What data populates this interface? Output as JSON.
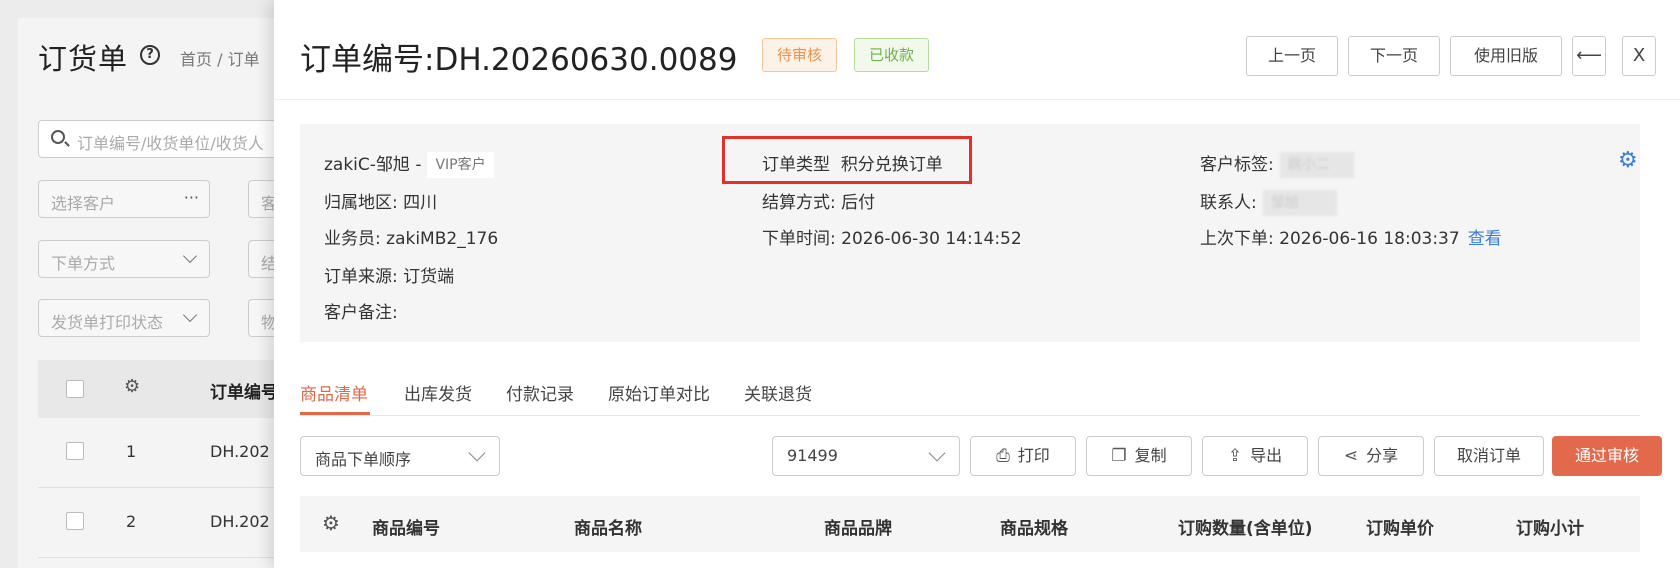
{
  "background": {
    "title": "订货单",
    "help_icon": "?",
    "breadcrumb": "首页 / 订单",
    "search_placeholder": "订单编号/收货单位/收货人",
    "filters": [
      {
        "label": "选择客户",
        "tail": "···"
      },
      {
        "label": "客"
      },
      {
        "label": "下单方式"
      },
      {
        "label": "结"
      },
      {
        "label": "发货单打印状态"
      },
      {
        "label": "物"
      }
    ],
    "table": {
      "order_no_header": "订单编号",
      "rows": [
        {
          "index": "1",
          "order_no": "DH.202"
        },
        {
          "index": "2",
          "order_no": "DH.202"
        }
      ]
    }
  },
  "drawer": {
    "order_label": "订单编号:DH.20260630.0089",
    "tags": {
      "pending": "待审核",
      "paid": "已收款"
    },
    "header_buttons": {
      "prev": "上一页",
      "next": "下一页",
      "old_version": "使用旧版",
      "collapse": "⟵",
      "close": "X"
    },
    "info": {
      "customer": "zakiC-邹旭 -",
      "customer_level": "VIP客户",
      "order_type_key": "订单类型",
      "order_type_val": "积分兑换订单",
      "customer_tag_key": "客户标签:",
      "customer_tag_val": "跳小二",
      "region_key": "归属地区:",
      "region_val": "四川",
      "settlement_key": "结算方式:",
      "settlement_val": "后付",
      "contact_key": "联系人:",
      "contact_val": "邹旭",
      "salesperson_key": "业务员:",
      "salesperson_val": "zakiMB2_176",
      "order_time_key": "下单时间:",
      "order_time_val": "2026-06-30 14:14:52",
      "last_order_key": "上次下单:",
      "last_order_val": "2026-06-16 18:03:37",
      "view_link": "查看",
      "source_key": "订单来源:",
      "source_val": "订货端",
      "remark_key": "客户备注:"
    },
    "tabs": [
      "商品清单",
      "出库发货",
      "付款记录",
      "原始订单对比",
      "关联退货"
    ],
    "toolbar": {
      "sort_select": "商品下单顺序",
      "warehouse_select": "91499",
      "print": "打印",
      "copy": "复制",
      "export": "导出",
      "share": "分享",
      "cancel": "取消订单",
      "approve": "通过审核"
    },
    "table_headers": [
      "商品编号",
      "商品名称",
      "商品品牌",
      "商品规格",
      "订购数量(含单位)",
      "订购单价",
      "订购小计"
    ],
    "colors": {
      "accent": "#e2694b",
      "link": "#3a7fd5",
      "highlight": "#e0322b"
    }
  }
}
